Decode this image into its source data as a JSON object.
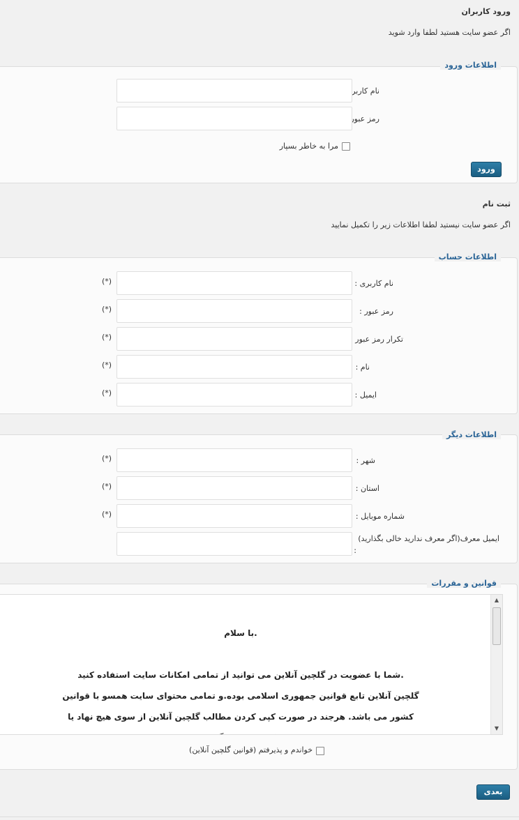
{
  "login": {
    "title": "ورود کاربران",
    "subtitle": "اگر عضو سایت هستید لطفا وارد شوید",
    "legend": "اطلاعات ورود",
    "username_label": "نام کاربری",
    "password_label": "رمز عبور",
    "remember_label": "مرا به خاطر بسپار",
    "submit_label": "ورود"
  },
  "register": {
    "title": "ثبت نام",
    "subtitle": "اگر عضو سایت نیستید لطفا اطلاعات زیر را تکمیل نمایید",
    "account_legend": "اطلاعات حساب",
    "account_fields": [
      {
        "label": "نام کاربری :",
        "required": "(*)"
      },
      {
        "label": "رمز عبور :",
        "required": "(*)"
      },
      {
        "label": "تکرار رمز عبور :",
        "required": "(*)"
      },
      {
        "label": "نام :",
        "required": "(*)"
      },
      {
        "label": "ایمیل :",
        "required": "(*)"
      }
    ],
    "other_legend": "اطلاعات دیگر",
    "other_fields": [
      {
        "label": "شهر :",
        "required": "(*)"
      },
      {
        "label": "استان :",
        "required": "(*)"
      },
      {
        "label": "شماره موبایل :",
        "required": "(*)"
      }
    ],
    "referrer_label": "ایمیل معرف(اگر معرف ندارید خالی بگذارید)",
    "referrer_colon": ":",
    "rules_legend": "قوانین و مقررات",
    "rules_text": [
      ".با سلام",
      "",
      ".شما با عضویت در گلچین آنلاین می توانید از تمامی امکانات سایت استفاده کنید",
      "گلچین آنلاین تابع قوانین جمهوری اسلامی بوده.و تمامی محتوای سایت همسو با قوانین",
      "کشور می باشد. هرجند در صورت کپی کردن مطالب گلچین آنلاین از سوی هیچ نهاد یا",
      "اشخاص حقیقی و حقوقی در صورت ذکر منبع هیچ گونه مانعی نخواهد داشت و مجاز می باشد"
    ],
    "accept_label": "خواندم و پذیرفتم (قوانین گلچین آنلاین)",
    "next_label": "بعدی"
  },
  "colors": {
    "accent": "#2a6496",
    "button": "#1b5e82",
    "background": "#f1f1f1"
  }
}
